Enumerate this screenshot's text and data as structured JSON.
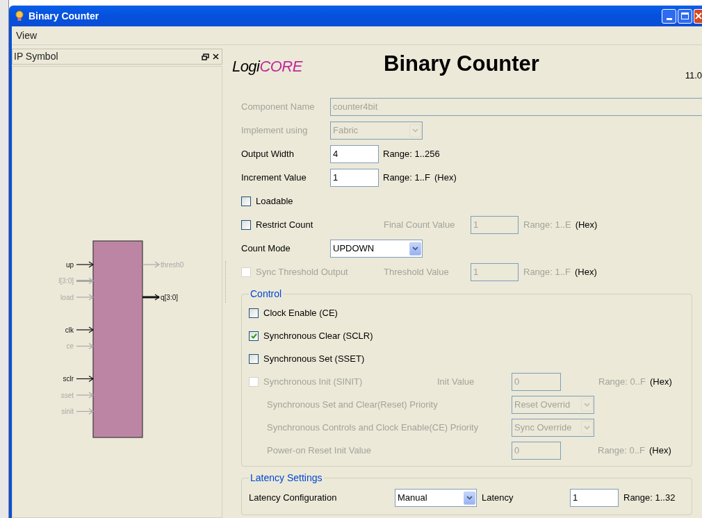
{
  "window": {
    "title": "Binary Counter"
  },
  "menu": [
    {
      "label": "View"
    }
  ],
  "ip_symbol": {
    "title": "IP Symbol",
    "input_groups": [
      [
        {
          "name": "up",
          "enabled": true,
          "bus": false
        },
        {
          "name": "l[3:0]",
          "enabled": false,
          "bus": true
        },
        {
          "name": "load",
          "enabled": false,
          "bus": false
        }
      ],
      [
        {
          "name": "clk",
          "enabled": true,
          "bus": false
        },
        {
          "name": "ce",
          "enabled": false,
          "bus": false
        }
      ],
      [
        {
          "name": "sclr",
          "enabled": true,
          "bus": false
        },
        {
          "name": "sset",
          "enabled": false,
          "bus": false
        },
        {
          "name": "sinit",
          "enabled": false,
          "bus": false
        }
      ]
    ],
    "outputs": [
      {
        "name": "thresh0",
        "enabled": false,
        "bus": false
      },
      {
        "name": "q[3:0]",
        "enabled": true,
        "bus": true
      }
    ]
  },
  "header": {
    "logo": [
      "Logi",
      "CORE"
    ],
    "title": "Binary Counter",
    "version": "11.0"
  },
  "settings": [
    {
      "kind": "text",
      "label": "Component Name",
      "value": "counter4bit",
      "disabled": true,
      "wide": true
    },
    {
      "kind": "select",
      "label": "Implement using",
      "value": "Fabric",
      "disabled": true
    },
    {
      "kind": "text",
      "label": "Output Width",
      "value": "4",
      "disabled": false,
      "range": "Range: 1..256"
    },
    {
      "kind": "text",
      "label": "Increment Value",
      "value": "1",
      "disabled": false,
      "range": "Range: 1..F",
      "unit": "(Hex)"
    },
    {
      "kind": "checkbox",
      "label": "Loadable",
      "checked": false,
      "disabled": false
    },
    {
      "kind": "checkbox",
      "label": "Restrict Count",
      "checked": false,
      "disabled": false,
      "sub": {
        "label": "Final Count Value",
        "value": "1",
        "disabled": true,
        "range": "Range: 1..E",
        "unit": "(Hex)"
      }
    },
    {
      "kind": "select",
      "label": "Count Mode",
      "value": "UPDOWN",
      "disabled": false
    },
    {
      "kind": "checkbox",
      "label": "Sync Threshold Output",
      "checked": false,
      "disabled": true,
      "sub": {
        "label": "Threshold Value",
        "value": "1",
        "disabled": true,
        "range": "Range: 1..F",
        "unit": "(Hex)"
      }
    }
  ],
  "groups": [
    {
      "title": "Control",
      "rows": [
        {
          "kind": "checkbox",
          "label": "Clock Enable (CE)",
          "checked": false,
          "disabled": false
        },
        {
          "kind": "checkbox",
          "label": "Synchronous Clear (SCLR)",
          "checked": true,
          "disabled": false
        },
        {
          "kind": "checkbox",
          "label": "Synchronous Set (SSET)",
          "checked": false,
          "disabled": false
        },
        {
          "kind": "checkbox",
          "label": "Synchronous Init (SINIT)",
          "checked": false,
          "disabled": true,
          "sub": {
            "label": "Init Value",
            "value": "0",
            "disabled": true,
            "range": "Range: 0..F",
            "unit": "(Hex)"
          }
        },
        {
          "kind": "select",
          "label": "Synchronous Set and Clear(Reset) Priority",
          "value": "Reset Overrid",
          "disabled": true
        },
        {
          "kind": "select",
          "label": "Synchronous Controls and Clock Enable(CE) Priority",
          "value": "Sync Override",
          "disabled": true
        },
        {
          "kind": "text",
          "label": "Power-on Reset Init Value",
          "value": "0",
          "disabled": true,
          "range": "Range: 0..F",
          "unit": "(Hex)"
        }
      ]
    },
    {
      "title": "Latency Settings",
      "rows": [
        {
          "kind": "select",
          "label": "Latency Configuration",
          "value": "Manual",
          "disabled": false,
          "sub": {
            "label": "Latency",
            "value": "1",
            "disabled": false,
            "range": "Range: 1..32"
          }
        }
      ]
    }
  ]
}
